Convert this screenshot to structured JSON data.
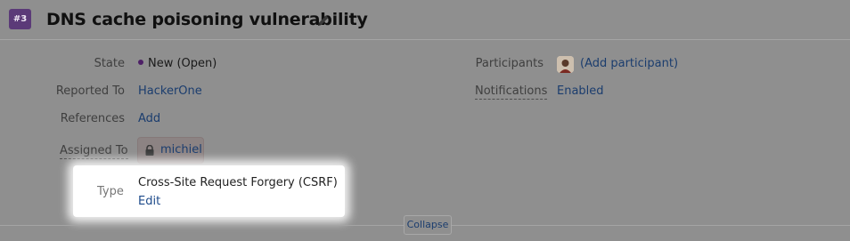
{
  "issue": {
    "number": "#3",
    "title": "DNS cache poisoning vulnerability"
  },
  "fields": {
    "state": {
      "label": "State",
      "value": "New (Open)"
    },
    "reported_to": {
      "label": "Reported To",
      "value": "HackerOne"
    },
    "references": {
      "label": "References",
      "value": "Add"
    },
    "assigned_to": {
      "label": "Assigned To",
      "value": "michiel"
    },
    "type": {
      "label": "Type",
      "value": "Cross-Site Request Forgery (CSRF)",
      "edit": "Edit"
    },
    "participants": {
      "label": "Participants",
      "value": "(Add participant)"
    },
    "notifications": {
      "label": "Notifications",
      "value": "Enabled"
    }
  },
  "collapse_label": "Collapse",
  "icons": [
    "pencil-icon",
    "lock-icon",
    "avatar"
  ],
  "colors": {
    "badge": "#5b3a78",
    "link": "#1b3d6e",
    "state_dot": "#4d1f66"
  }
}
